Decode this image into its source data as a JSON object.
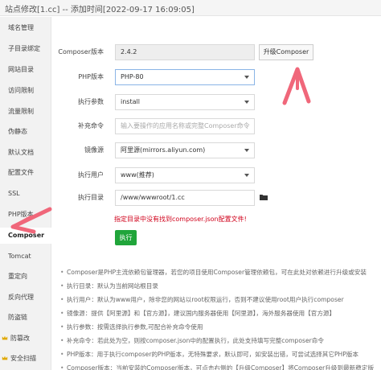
{
  "window": {
    "title": "站点修改[1.cc] -- 添加时间[2022-09-17 16:09:05]"
  },
  "sidebar": {
    "items": [
      {
        "label": "域名管理"
      },
      {
        "label": "子目录绑定"
      },
      {
        "label": "网站目录"
      },
      {
        "label": "访问限制"
      },
      {
        "label": "流量限制"
      },
      {
        "label": "伪静态"
      },
      {
        "label": "默认文档"
      },
      {
        "label": "配置文件"
      },
      {
        "label": "SSL"
      },
      {
        "label": "PHP版本"
      },
      {
        "label": "Composer"
      },
      {
        "label": "Tomcat"
      },
      {
        "label": "重定向"
      },
      {
        "label": "反向代理"
      },
      {
        "label": "防盗链"
      },
      {
        "label": "防篡改",
        "icon": "crown-icon"
      },
      {
        "label": "安全扫描",
        "icon": "crown-icon"
      }
    ],
    "active_index": 10
  },
  "form": {
    "composer_version": {
      "label": "Composer版本",
      "value": "2.4.2"
    },
    "upgrade_button": "升级Composer",
    "php_version": {
      "label": "PHP版本",
      "value": "PHP-80"
    },
    "exec_args": {
      "label": "执行参数",
      "value": "install"
    },
    "extra_cmd": {
      "label": "补充命令",
      "placeholder": "输入要操作的应用名称或完整Composer命令"
    },
    "mirror": {
      "label": "镜像源",
      "value": "阿里源(mirrors.aliyun.com)"
    },
    "exec_user": {
      "label": "执行用户",
      "value": "www(推荐)"
    },
    "exec_dir": {
      "label": "执行目录",
      "value": "/www/wwwroot/1.cc",
      "icon": "folder-icon"
    },
    "warning": "指定目录中没有找到composer.json配置文件!",
    "execute_button": "执行"
  },
  "notes": [
    "Composer是PHP主流依赖包管理器，若您的项目使用Composer管理依赖包，可在此处对依赖进行升级或安装",
    "执行目录：默认为当前网站根目录",
    "执行用户：默认为www用户，除非您的网站以root权限运行，否则不建议使用root用户执行composer",
    "镜像源：提供【阿里源】和【官方源】，建议国内服务器使用【阿里源】，海外服务器使用【官方源】",
    "执行参数：按需选择执行参数,可配合补充命令使用",
    "补充命令：若此处为空，则按composer.json中的配置执行，此处支持填写完整composer命令",
    "PHP版本：用于执行composer的PHP版本，无特殊要求，默认即可，如安装出错，可尝试选择其它PHP版本",
    "Composer版本：当前安装的Composer版本，可点击右侧的【升级Composer】将Composer升级到最新稳定版"
  ],
  "colors": {
    "accent_green": "#20a53a",
    "warning_red": "#d0021b",
    "annotation_arrow": "#f0677a",
    "crown_gold": "#e0a800"
  }
}
